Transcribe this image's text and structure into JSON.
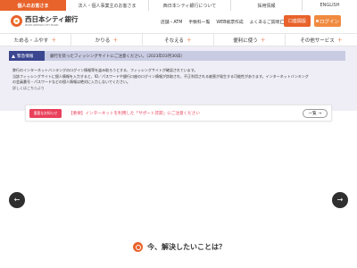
{
  "topbar": {
    "personal": "個人のお客さま",
    "corporate": "法人・個人事業主のお客さま",
    "about": "西日本シティ銀行について",
    "recruit": "採用情報",
    "english": "ENGLISH"
  },
  "header": {
    "logo_name": "西日本シティ銀行",
    "logo_sub": "NISHI-NIPPON CITY BANK",
    "links": [
      "店舗・ATM",
      "手数料一覧",
      "WEB帳票作成",
      "よくあるご質問"
    ],
    "open_account": "口座開設",
    "login": "ログイン"
  },
  "nav": {
    "items": [
      "ためる・ふやす",
      "かりる",
      "そなえる",
      "便利に使う",
      "その他サービス"
    ]
  },
  "alert": {
    "badge": "緊急情報",
    "title": "銀行を装ったフィッシングサイトにご注意ください。（2023年03月30日）",
    "lines": [
      "弊行のインターネットバンキングのログイン情報等を盗み取ろうとする、フィッシングサイトが確認されています。",
      "当該フィッシングサイトに個人情報を入力すると、ID／パスワードや銀行口座のログイン情報が詐取され、不正利用される被害が発生する可能性があります。インターネットバンキング",
      "の会員番号・パスワードなどの個人情報は絶対に入力しないでください。"
    ],
    "more_link": "詳しくはこちらより"
  },
  "notice": {
    "badge": "重要なお知らせ",
    "text": "【重要】インターネットを利用した「サポート詐欺」にご注意ください",
    "list_button": "一覧"
  },
  "bottom": {
    "heading": "今、解決したいことは？"
  },
  "colors": {
    "brand_orange": "#e8632b",
    "alert_navy": "#3a468f",
    "notice_red": "#e9415b"
  }
}
